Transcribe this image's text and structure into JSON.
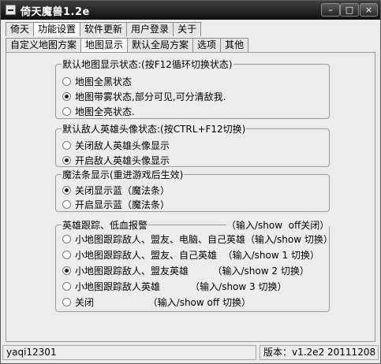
{
  "window": {
    "title": "倚天魔兽1.2e",
    "minimize": "–",
    "maximize": "□",
    "close": "×"
  },
  "main_tabs": [
    "倚天",
    "功能设置",
    "软件更新",
    "用户登录",
    "关于"
  ],
  "sub_tabs": [
    "自定义地图方案",
    "地图显示",
    "默认全局方案",
    "选项",
    "其他"
  ],
  "groups": {
    "map_display": {
      "title": "默认地图显示状态:(按F12循环切换状态)",
      "options": [
        "地图全黑状态",
        "地图带雾状态,部分可见,可分清敌我.",
        "地图全亮状态."
      ],
      "selected": 1
    },
    "enemy_hero": {
      "title": "默认敌人英雄头像状态:(按CTRL+F12切换)",
      "options": [
        "关闭敌人英雄头像显示",
        "开启敌人英雄头像显示"
      ],
      "selected": 1
    },
    "mana_bar": {
      "title": "魔法条显示(重进游戏后生效)",
      "options": [
        "关闭显示蓝（魔法条）",
        "开启显示蓝（魔法条）"
      ],
      "selected": 0
    },
    "hero_tracking": {
      "title": "英雄跟踪、低血报警",
      "title_hint": "（输入/show  off关闭）",
      "options": [
        "小地图跟踪敌人、盟友、电脑、自己英雄（输入/show 切换）",
        "小地图跟踪敌人、盟友、自己英雄  （输入/show 1 切换）",
        "小地图跟踪敌人、盟友英雄        （输入/show 2 切换）",
        "小地图跟踪敌人英雄          （输入/show 3 切换）",
        "关闭                  （输入/show off 切换）"
      ],
      "selected": 2
    }
  },
  "status": {
    "user": "yaqi12301",
    "version": "版本：v1.2e2 20111208"
  }
}
